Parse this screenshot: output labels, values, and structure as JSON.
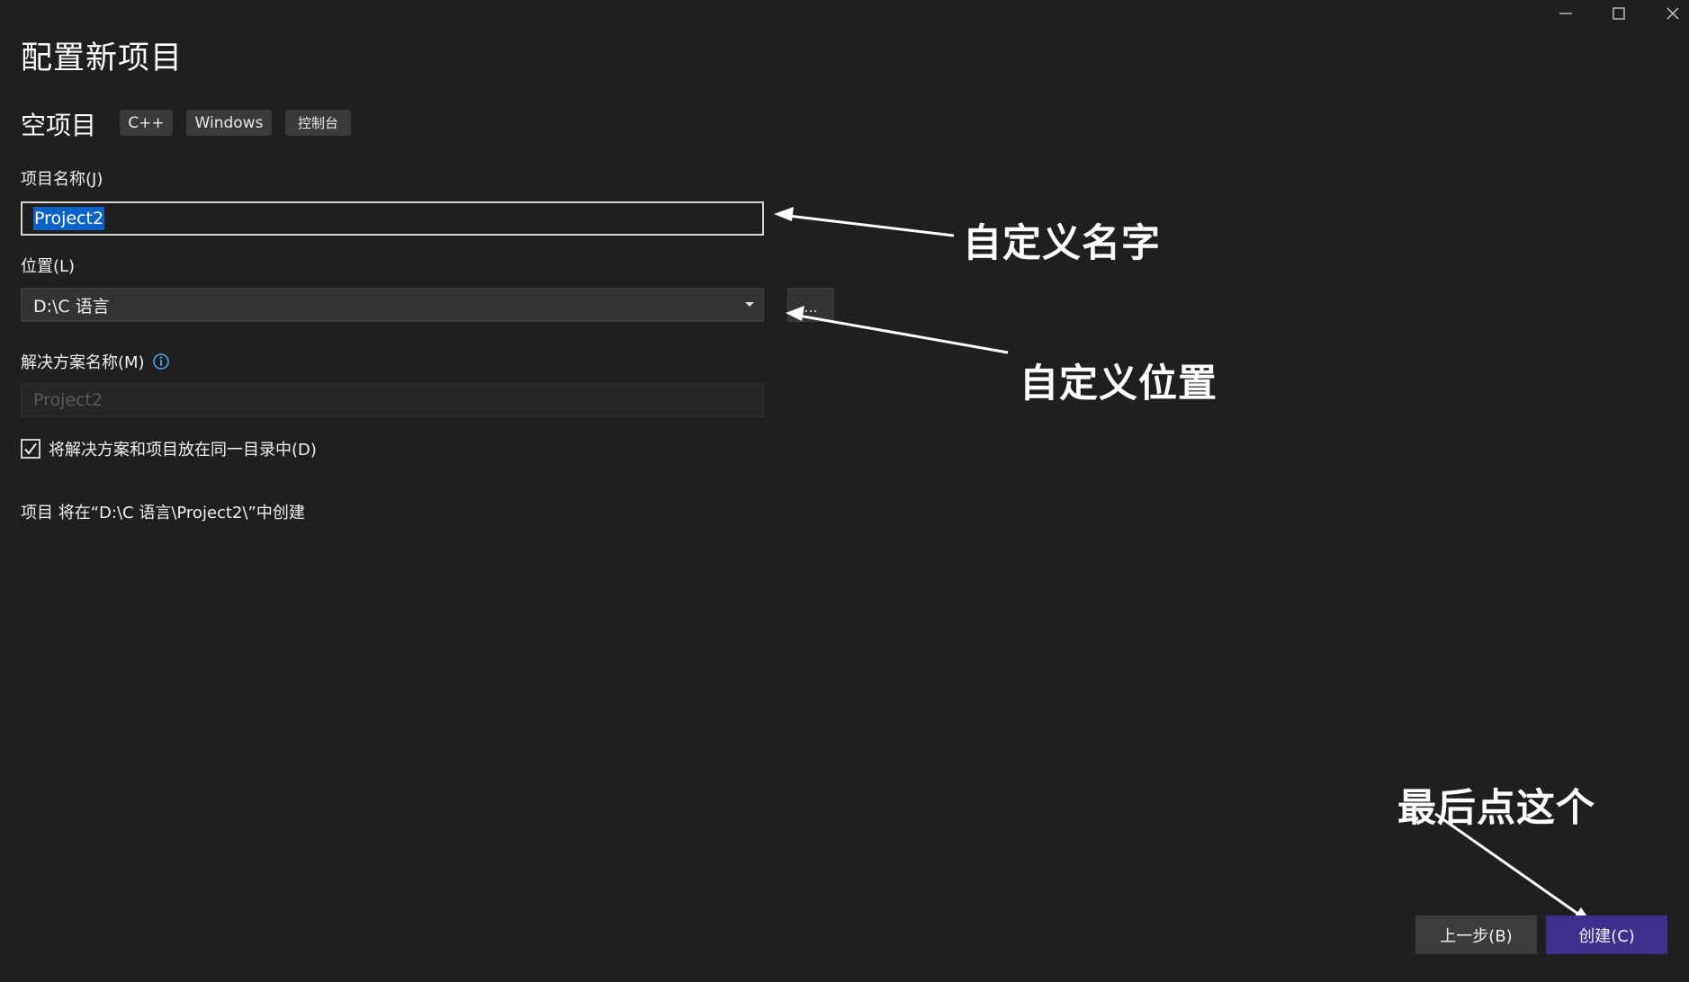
{
  "window": {
    "controls": [
      "minimize",
      "maximize",
      "close"
    ]
  },
  "page": {
    "title": "配置新项目"
  },
  "template": {
    "name": "空项目",
    "tags": [
      "C++",
      "Windows",
      "控制台"
    ]
  },
  "form": {
    "project_name_label": "项目名称(J)",
    "project_name_value": "Project2",
    "location_label": "位置(L)",
    "location_value": "D:\\C 语言",
    "browse_label": "...",
    "solution_name_label": "解决方案名称(M)",
    "solution_name_placeholder": "Project2",
    "same_dir_checkbox_label": "将解决方案和项目放在同一目录中(D)",
    "same_dir_checked": true,
    "create_info": "项目 将在“D:\\C 语言\\Project2\\”中创建"
  },
  "annotations": {
    "name_note": "自定义名字",
    "location_note": "自定义位置",
    "last_note": "最后点这个"
  },
  "buttons": {
    "back_label": "上一步(B)",
    "create_label": "创建(C)"
  },
  "colors": {
    "background": "#1f1f1f",
    "selection": "#0b62c8",
    "create_button": "#3e2f8c",
    "info_icon": "#4aa8e8"
  }
}
